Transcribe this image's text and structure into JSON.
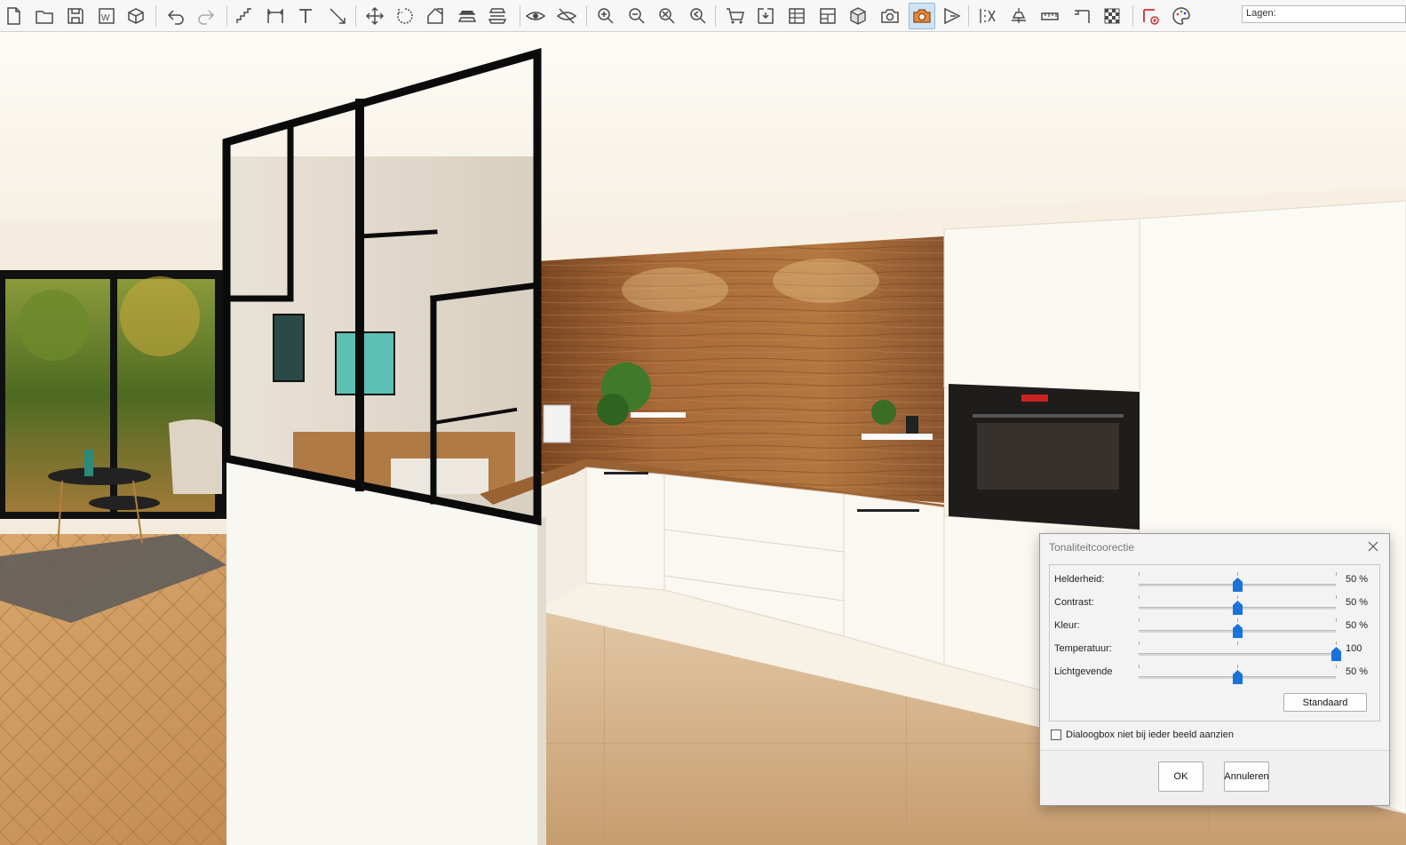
{
  "toolbar": {
    "layers_label": "Lagen:",
    "icons": [
      "new-file-icon",
      "open-folder-icon",
      "save-icon",
      "word-export-icon",
      "sketchup-export-icon",
      "undo-icon",
      "redo-icon",
      "stairs-icon",
      "dimension-icon",
      "text-icon",
      "line-arrow-icon",
      "move-icon",
      "rotate-icon",
      "stretch-icon",
      "slice-horizontal-icon",
      "slice-vertical-icon",
      "eye-icon",
      "eye-hidden-icon",
      "zoom-in-icon",
      "zoom-out-icon",
      "zoom-fit-icon",
      "zoom-previous-icon",
      "cart-icon",
      "elevation-icon",
      "grid-table-icon",
      "layout-table-icon",
      "cube-3d-icon",
      "camera-icon",
      "camera-render-icon",
      "walkthrough-icon",
      "tools-list-icon",
      "lamp-icon",
      "ruler-icon",
      "angle-icon",
      "checker-icon",
      "node-add-icon",
      "palette-icon"
    ],
    "active_icon": "camera-render-icon"
  },
  "dialog": {
    "title": "Tonaliteitcoorectie",
    "sliders": [
      {
        "label": "Helderheid:",
        "value_text": "50 %",
        "value": 50
      },
      {
        "label": "Contrast:",
        "value_text": "50 %",
        "value": 50
      },
      {
        "label": "Kleur:",
        "value_text": "50 %",
        "value": 50
      },
      {
        "label": "Temperatuur:",
        "value_text": "100",
        "value": 100
      },
      {
        "label": "Lichtgevende",
        "value_text": "50 %",
        "value": 50
      }
    ],
    "default_button": "Standaard",
    "checkbox_label": "Dialoogbox niet bij ieder beeld aanzien",
    "checkbox_checked": false,
    "ok_button": "OK",
    "cancel_button": "Annuleren"
  },
  "colors": {
    "accent": "#1a73d9",
    "toolbar_bg": "#f7f7f7",
    "wood": "#8a5530",
    "cabinet": "#fbf8f2",
    "floor": "#caa27a",
    "active_tool_icon": "#e6893a"
  }
}
